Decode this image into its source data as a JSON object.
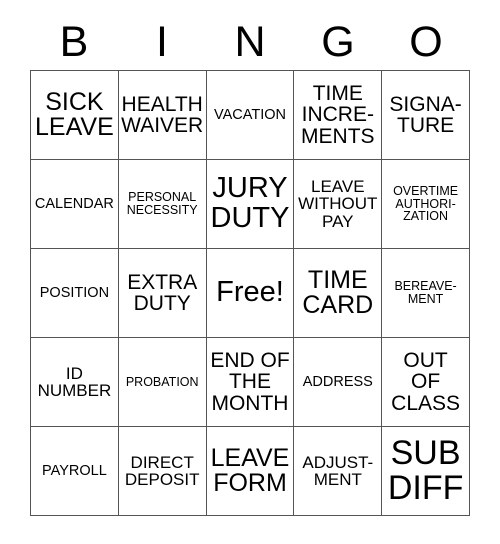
{
  "card": {
    "header_letters": [
      "B",
      "I",
      "N",
      "G",
      "O"
    ],
    "rows": [
      [
        {
          "text": "SICK\nLEAVE",
          "size": "xl"
        },
        {
          "text": "HEALTH\nWAIVER",
          "size": "l"
        },
        {
          "text": "VACATION",
          "size": "s"
        },
        {
          "text": "TIME\nINCRE-\nMENTS",
          "size": "l"
        },
        {
          "text": "SIGNA-\nTURE",
          "size": "l"
        }
      ],
      [
        {
          "text": "CALENDAR",
          "size": "s"
        },
        {
          "text": "PERSONAL\nNECESSITY",
          "size": "xs"
        },
        {
          "text": "JURY\nDUTY",
          "size": "xxl"
        },
        {
          "text": "LEAVE\nWITHOUT\nPAY",
          "size": "m"
        },
        {
          "text": "OVERTIME\nAUTHORI-\nZATION",
          "size": "xs"
        }
      ],
      [
        {
          "text": "POSITION",
          "size": "s"
        },
        {
          "text": "EXTRA\nDUTY",
          "size": "l"
        },
        {
          "text": "Free!",
          "size": "xxl"
        },
        {
          "text": "TIME\nCARD",
          "size": "xl"
        },
        {
          "text": "BEREAVE-\nMENT",
          "size": "xs"
        }
      ],
      [
        {
          "text": "ID\nNUMBER",
          "size": "m"
        },
        {
          "text": "PROBATION",
          "size": "xs"
        },
        {
          "text": "END OF\nTHE\nMONTH",
          "size": "l"
        },
        {
          "text": "ADDRESS",
          "size": "s"
        },
        {
          "text": "OUT\nOF\nCLASS",
          "size": "l"
        }
      ],
      [
        {
          "text": "PAYROLL",
          "size": "s"
        },
        {
          "text": "DIRECT\nDEPOSIT",
          "size": "m"
        },
        {
          "text": "LEAVE\nFORM",
          "size": "xl"
        },
        {
          "text": "ADJUST-\nMENT",
          "size": "m"
        },
        {
          "text": "SUB\nDIFF",
          "size": "huge"
        }
      ]
    ],
    "free_space": "Free!",
    "colors": {
      "border": "#555555",
      "cell_background": "#ffffff",
      "text": "#000000",
      "page_background": "#ffffff"
    }
  }
}
